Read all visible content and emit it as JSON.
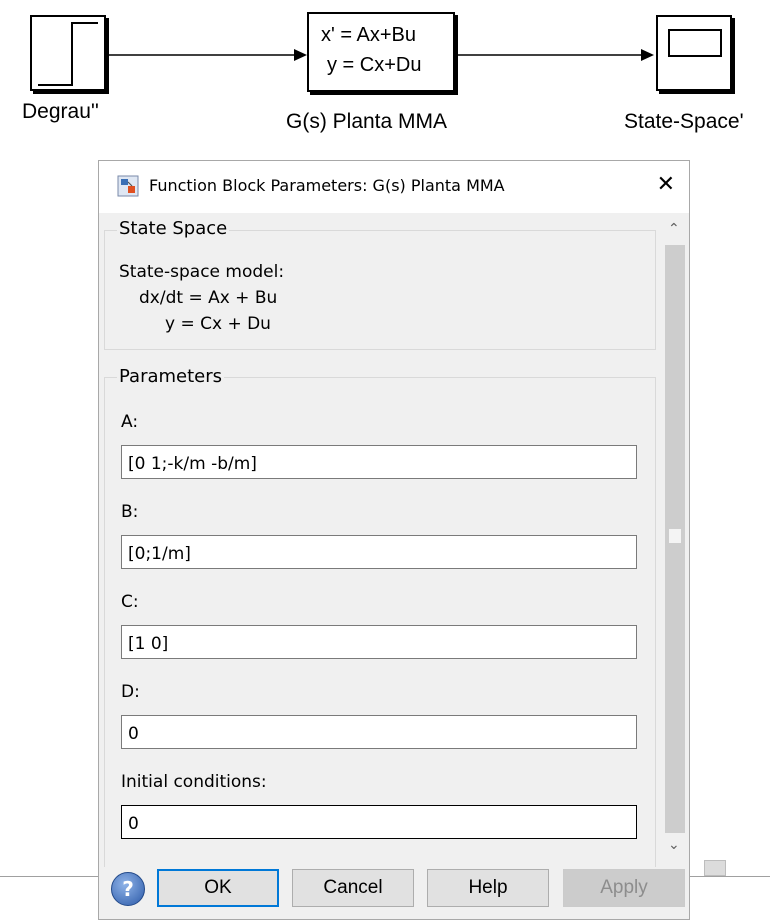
{
  "canvas": {
    "step_block_label": "Degrau''",
    "plant_block_label": "G(s) Planta MMA",
    "plant_eq_line1": "x' = Ax+Bu",
    "plant_eq_line2": "y = Cx+Du",
    "scope_block_label": "State-Space'"
  },
  "dialog": {
    "title": "Function Block Parameters: G(s) Planta MMA",
    "state_space_group": {
      "legend": "State Space",
      "line1": "State-space model:",
      "line2": "dx/dt = Ax + Bu",
      "line3": "y = Cx + Du"
    },
    "parameters_group": {
      "legend": "Parameters",
      "fields": [
        {
          "label": "A:",
          "value": "[0 1;-k/m -b/m]"
        },
        {
          "label": "B:",
          "value": "[0;1/m]"
        },
        {
          "label": "C:",
          "value": "[1 0]"
        },
        {
          "label": "D:",
          "value": "0"
        },
        {
          "label": "Initial conditions:",
          "value": "0"
        }
      ]
    },
    "buttons": {
      "ok": "OK",
      "cancel": "Cancel",
      "help": "Help",
      "apply": "Apply"
    }
  }
}
